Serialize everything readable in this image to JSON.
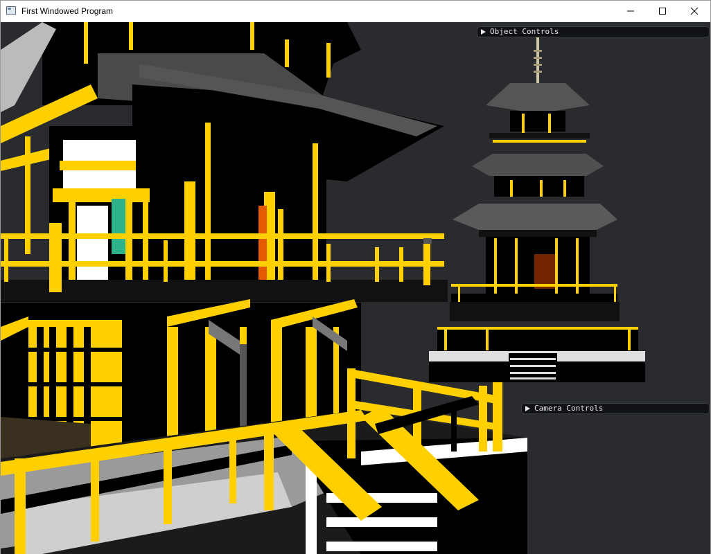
{
  "window": {
    "title": "First Windowed Program",
    "icon": "app-window-icon",
    "controls": {
      "minimize_icon": "minimize-icon",
      "maximize_icon": "maximize-icon",
      "close_icon": "close-icon"
    }
  },
  "panels": {
    "object_controls": {
      "label": "Object Controls",
      "expanded": false
    },
    "camera_controls": {
      "label": "Camera Controls",
      "expanded": false
    }
  },
  "scene": {
    "background_color": "#2a2b2f",
    "accent_color": "#ffe000",
    "roof_color": "#4a4a4a",
    "floor_color": "#d8d8d8"
  }
}
